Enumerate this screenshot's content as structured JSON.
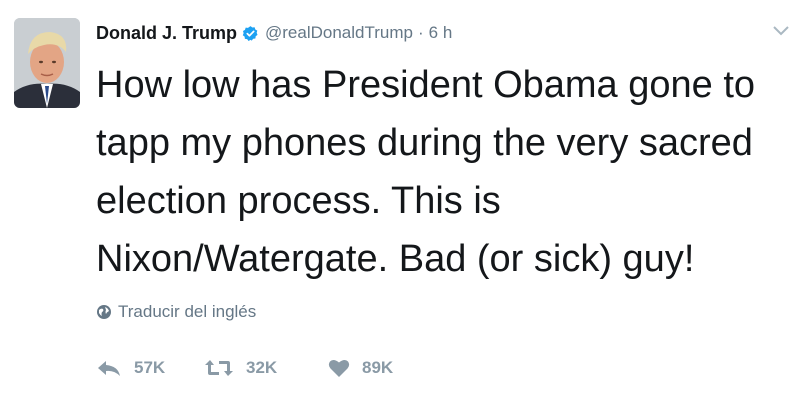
{
  "tweet": {
    "author_name": "Donald J. Trump",
    "handle": "@realDonaldTrump",
    "separator": "·",
    "time": "6 h",
    "text": "How low has President Obama gone to tapp my phones during the very sacred election process. This is Nixon/Watergate. Bad (or sick) guy!",
    "translate_label": "Traducir del inglés",
    "verified": true
  },
  "actions": {
    "reply_count": "57K",
    "retweet_count": "32K",
    "like_count": "89K"
  },
  "icons": {
    "verified": "verified-badge-icon",
    "caret": "chevron-down-icon",
    "translate": "globe-icon",
    "reply": "reply-arrow-icon",
    "retweet": "retweet-icon",
    "like": "heart-icon"
  },
  "colors": {
    "text": "#14171a",
    "muted": "#657786",
    "action": "#8a9aa6",
    "verified": "#1da1f2"
  }
}
